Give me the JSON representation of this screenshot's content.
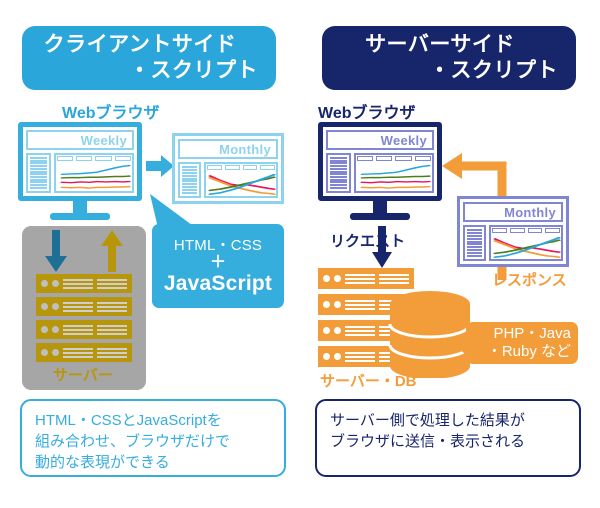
{
  "colors": {
    "client_blue": "#2BA6DA",
    "client_blue_light": "#8DD3EF",
    "server_navy": "#17256B",
    "server_navy_light": "#8186D4",
    "orange": "#F39C3A",
    "gold": "#B8960C",
    "grey_plate": "#A6A6A6",
    "teal_arrow": "#1D6F96"
  },
  "client": {
    "header": {
      "line1": "クライアントサイド",
      "line2": "・スクリプト"
    },
    "browser_label": "Webブラウザ",
    "monitor": {
      "title": "Weekly"
    },
    "secondary_panel": {
      "title": "Monthly"
    },
    "server": {
      "caption": "サーバー"
    },
    "callout": {
      "line1": "HTML・CSS",
      "line2": "＋",
      "line3": "JavaScript"
    },
    "caption": {
      "line1": "HTML・CSSとJavaScriptを",
      "line2": "組み合わせ、ブラウザだけで",
      "line3": "動的な表現ができる"
    }
  },
  "server": {
    "header": {
      "line1": "サーバーサイド",
      "line2": "・スクリプト"
    },
    "browser_label": "Webブラウザ",
    "monitor": {
      "title": "Weekly"
    },
    "secondary_panel": {
      "title": "Monthly"
    },
    "request_label": "リクエスト",
    "response_label": "レスポンス",
    "server_db": {
      "caption": "サーバー・DB"
    },
    "callout": {
      "line1": "PHP・Java",
      "line2": "・Ruby など"
    },
    "caption": {
      "line1": "サーバー側で処理した結果が",
      "line2": "ブラウザに送信・表示される"
    }
  },
  "chart_data": [
    {
      "type": "line",
      "title": "Weekly",
      "series": [
        {
          "name": "blue",
          "color": "#29A7DD",
          "values": [
            34,
            33,
            32,
            30,
            28,
            22,
            16,
            12,
            10
          ]
        },
        {
          "name": "green",
          "color": "#4E7D1E",
          "values": [
            44,
            43,
            43,
            42,
            42,
            41,
            40,
            40,
            39
          ]
        },
        {
          "name": "pink",
          "color": "#E8145F",
          "values": [
            56,
            57,
            55,
            56,
            54,
            55,
            54,
            55,
            54
          ]
        },
        {
          "name": "orange",
          "color": "#F39C3A",
          "values": [
            70,
            71,
            70,
            72,
            70,
            70,
            69,
            69,
            68
          ]
        }
      ],
      "xlabel": "",
      "ylabel": "",
      "grid": false,
      "legend": "none"
    },
    {
      "type": "line",
      "title": "Monthly",
      "series": [
        {
          "name": "pink",
          "color": "#E8145F",
          "values": [
            16,
            30,
            42,
            46,
            44,
            48,
            52,
            56,
            58
          ]
        },
        {
          "name": "orange",
          "color": "#F39C3A",
          "values": [
            22,
            34,
            46,
            54,
            60,
            66,
            70,
            72,
            74
          ]
        },
        {
          "name": "green",
          "color": "#4E7D1E",
          "values": [
            62,
            58,
            52,
            46,
            40,
            34,
            28,
            24,
            20
          ]
        },
        {
          "name": "blue",
          "color": "#29A7DD",
          "values": [
            74,
            70,
            62,
            54,
            44,
            34,
            26,
            18,
            12
          ]
        }
      ],
      "xlabel": "",
      "ylabel": "",
      "grid": false,
      "legend": "none"
    }
  ]
}
